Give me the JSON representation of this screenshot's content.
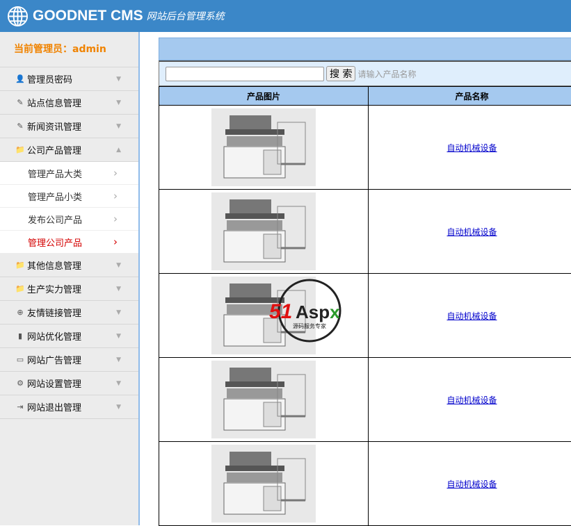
{
  "header": {
    "brand": "GOODNET CMS",
    "subtitle": "网站后台管理系统"
  },
  "sidebar": {
    "current_admin": "当前管理员：admin",
    "menu": [
      {
        "label": "管理员密码",
        "icon": "user-icon",
        "glyph": "👤"
      },
      {
        "label": "站点信息管理",
        "icon": "note-icon",
        "glyph": "✎"
      },
      {
        "label": "新闻资讯管理",
        "icon": "note-icon",
        "glyph": "✎"
      },
      {
        "label": "公司产品管理",
        "icon": "folder-icon",
        "glyph": "📁",
        "expanded": true
      },
      {
        "label": "其他信息管理",
        "icon": "folder-icon",
        "glyph": "📁"
      },
      {
        "label": "生产实力管理",
        "icon": "folder-icon",
        "glyph": "📁"
      },
      {
        "label": "友情链接管理",
        "icon": "globe-icon",
        "glyph": "⊕"
      },
      {
        "label": "网站优化管理",
        "icon": "bar-chart-icon",
        "glyph": "▮"
      },
      {
        "label": "网站广告管理",
        "icon": "monitor-icon",
        "glyph": "▭"
      },
      {
        "label": "网站设置管理",
        "icon": "gear-icon",
        "glyph": "⚙"
      },
      {
        "label": "网站退出管理",
        "icon": "logout-icon",
        "glyph": "⇥"
      }
    ],
    "submenu": [
      {
        "label": "管理产品大类"
      },
      {
        "label": "管理产品小类"
      },
      {
        "label": "发布公司产品"
      },
      {
        "label": "管理公司产品",
        "active": true
      }
    ]
  },
  "search": {
    "value": "",
    "button": "搜 索",
    "hint": "请输入产品名称"
  },
  "table": {
    "headers": [
      "产品图片",
      "产品名称"
    ],
    "rows": [
      {
        "name": "自动机械设备"
      },
      {
        "name": "自动机械设备"
      },
      {
        "name": "自动机械设备"
      },
      {
        "name": "自动机械设备"
      },
      {
        "name": "自动机械设备"
      }
    ]
  },
  "watermark": {
    "text": "51Aspx",
    "sub": "源码服务专家"
  },
  "colors": {
    "header": "#3b87c8",
    "accent": "#f08300",
    "active": "#d40000"
  }
}
